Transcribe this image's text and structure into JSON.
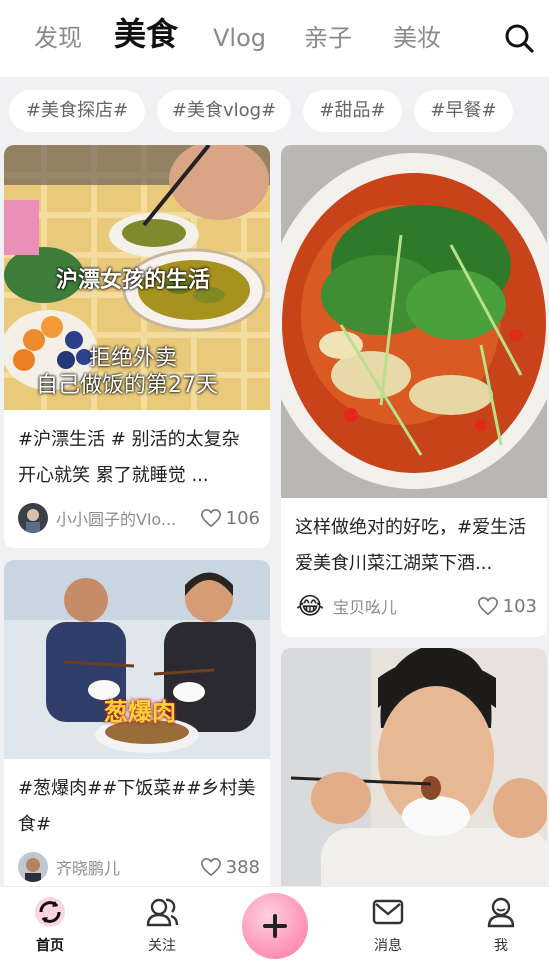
{
  "nav": {
    "tabs": [
      {
        "label": "发现"
      },
      {
        "label": "美食"
      },
      {
        "label": "Vlog"
      },
      {
        "label": "亲子"
      },
      {
        "label": "美妆"
      }
    ],
    "active_tab": "美食",
    "search_icon": "search-icon"
  },
  "hashtags": [
    "#美食探店#",
    "#美食vlog#",
    "#甜品#",
    "#早餐#"
  ],
  "cards": {
    "left": [
      {
        "overlay_title": "沪漂女孩的生活",
        "overlay_sub1": "拒绝外卖",
        "overlay_sub2": "自己做饭的第27天",
        "title": "#沪漂生活 # 别活的太复杂 开心就笑 累了就睡觉 ...",
        "author": "小小圆子的Vlo...",
        "likes": "106"
      },
      {
        "overlay_title": "葱爆肉",
        "title": "#葱爆肉##下饭菜##乡村美食#",
        "author": "齐晓鹏儿",
        "likes": "388"
      }
    ],
    "right": [
      {
        "title": "这样做绝对的好吃，#爱生活爱美食川菜江湖菜下酒...",
        "author": "宝贝吆儿",
        "avatar_emoji": "😂",
        "likes": "103"
      },
      {}
    ]
  },
  "bottom_nav": [
    {
      "label": "首页",
      "icon": "home-refresh-icon"
    },
    {
      "label": "关注",
      "icon": "follow-icon"
    },
    {
      "label": "",
      "icon": "plus-icon"
    },
    {
      "label": "消息",
      "icon": "message-icon"
    },
    {
      "label": "我",
      "icon": "profile-icon"
    }
  ],
  "colors": {
    "accent_pink": "#ff8fb5",
    "background": "#f1f1f3"
  }
}
